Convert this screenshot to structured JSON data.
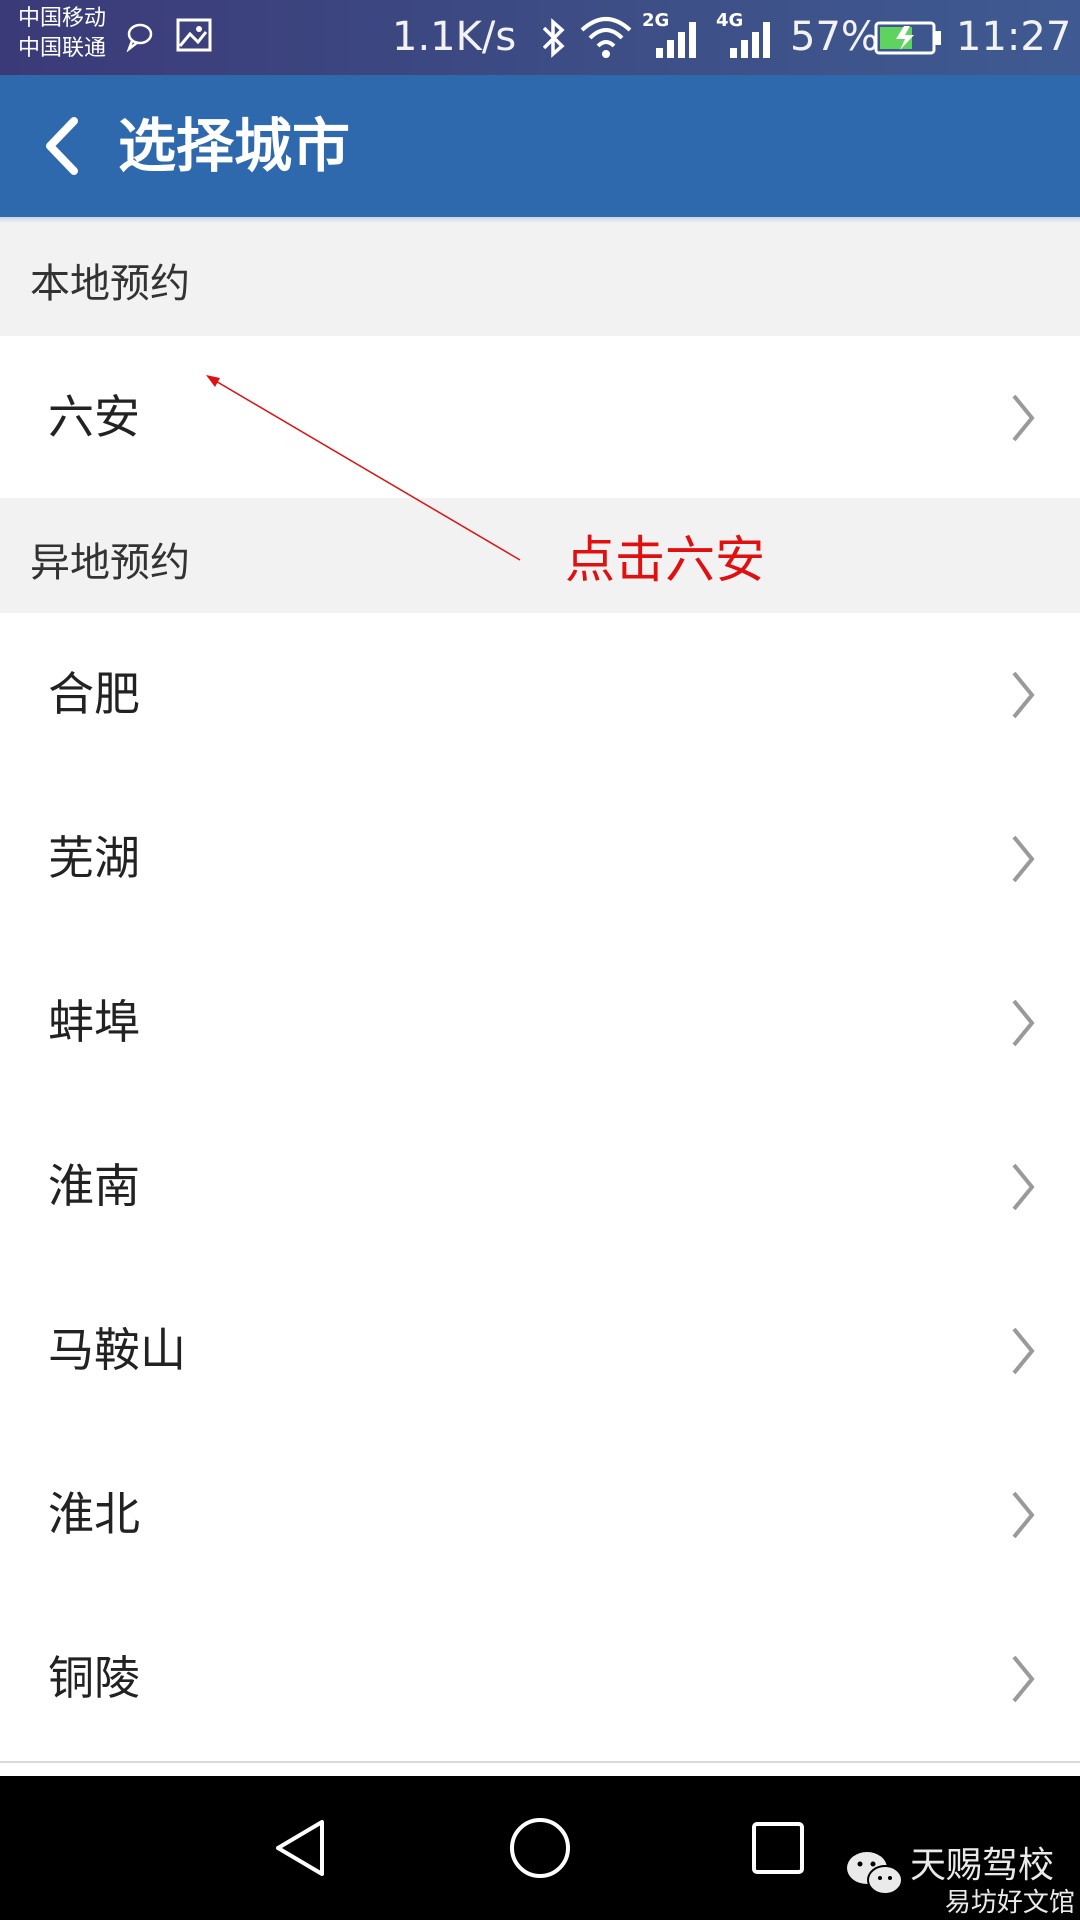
{
  "status_bar": {
    "carrier_1": "中国移动",
    "carrier_2": "中国联通",
    "net_speed": "1.1K/s",
    "sim1_type": "2G",
    "sim2_type": "4G",
    "battery": "57%",
    "time": "11:27"
  },
  "header": {
    "title": "选择城市"
  },
  "local_section": {
    "label": "本地预约",
    "items": [
      {
        "name": "六安"
      }
    ]
  },
  "remote_section": {
    "label": "异地预约",
    "items": [
      {
        "name": "合肥"
      },
      {
        "name": "芜湖"
      },
      {
        "name": "蚌埠"
      },
      {
        "name": "淮南"
      },
      {
        "name": "马鞍山"
      },
      {
        "name": "淮北"
      },
      {
        "name": "铜陵"
      }
    ]
  },
  "annotation": {
    "text": "点击六安",
    "color": "#e01010"
  },
  "watermark": {
    "brand": "天赐驾校",
    "site": "易坊好文馆"
  },
  "colors": {
    "header_bg": "#2f69ad",
    "section_bg": "#f2f2f2",
    "navbar_bg": "#000000"
  }
}
